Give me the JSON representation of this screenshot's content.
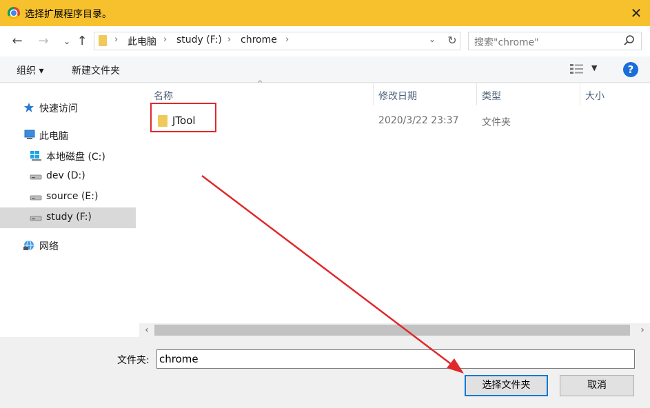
{
  "window": {
    "title": "选择扩展程序目录。",
    "close_glyph": "✕"
  },
  "nav": {
    "back_glyph": "←",
    "forward_glyph": "→",
    "recent_glyph": "⌄",
    "up_glyph": "↑",
    "breadcrumb": [
      "此电脑",
      "study (F:)",
      "chrome"
    ],
    "separator": "›",
    "dropdown_glyph": "⌄",
    "refresh_glyph": "↻",
    "search_placeholder": "搜索\"chrome\""
  },
  "toolbar": {
    "organize": "组织 ▾",
    "new_folder": "新建文件夹",
    "view_dropdown": "▼",
    "help": "?"
  },
  "sidebar": {
    "items": [
      {
        "label": "快速访问",
        "icon": "star-icon"
      },
      {
        "label": "此电脑",
        "icon": "computer-icon"
      },
      {
        "label": "本地磁盘 (C:)",
        "icon": "windows-drive-icon"
      },
      {
        "label": "dev (D:)",
        "icon": "drive-icon"
      },
      {
        "label": "source (E:)",
        "icon": "drive-icon"
      },
      {
        "label": "study (F:)",
        "icon": "drive-icon",
        "selected": true
      },
      {
        "label": "网络",
        "icon": "network-icon"
      }
    ]
  },
  "filelist": {
    "columns": [
      "名称",
      "修改日期",
      "类型",
      "大小"
    ],
    "sort_glyph": "^",
    "rows": [
      {
        "name": "JTool",
        "modified": "2020/3/22 23:37",
        "type": "文件夹",
        "size": ""
      }
    ]
  },
  "scrollbar": {
    "left_glyph": "‹",
    "right_glyph": "›"
  },
  "bottom": {
    "folder_label": "文件夹:",
    "folder_value": "chrome",
    "select_button": "选择文件夹",
    "cancel_button": "取消"
  },
  "colors": {
    "titlebar": "#f7c12e",
    "accent": "#0078d7",
    "annotation": "#e0282a",
    "folder": "#f0c95a"
  }
}
